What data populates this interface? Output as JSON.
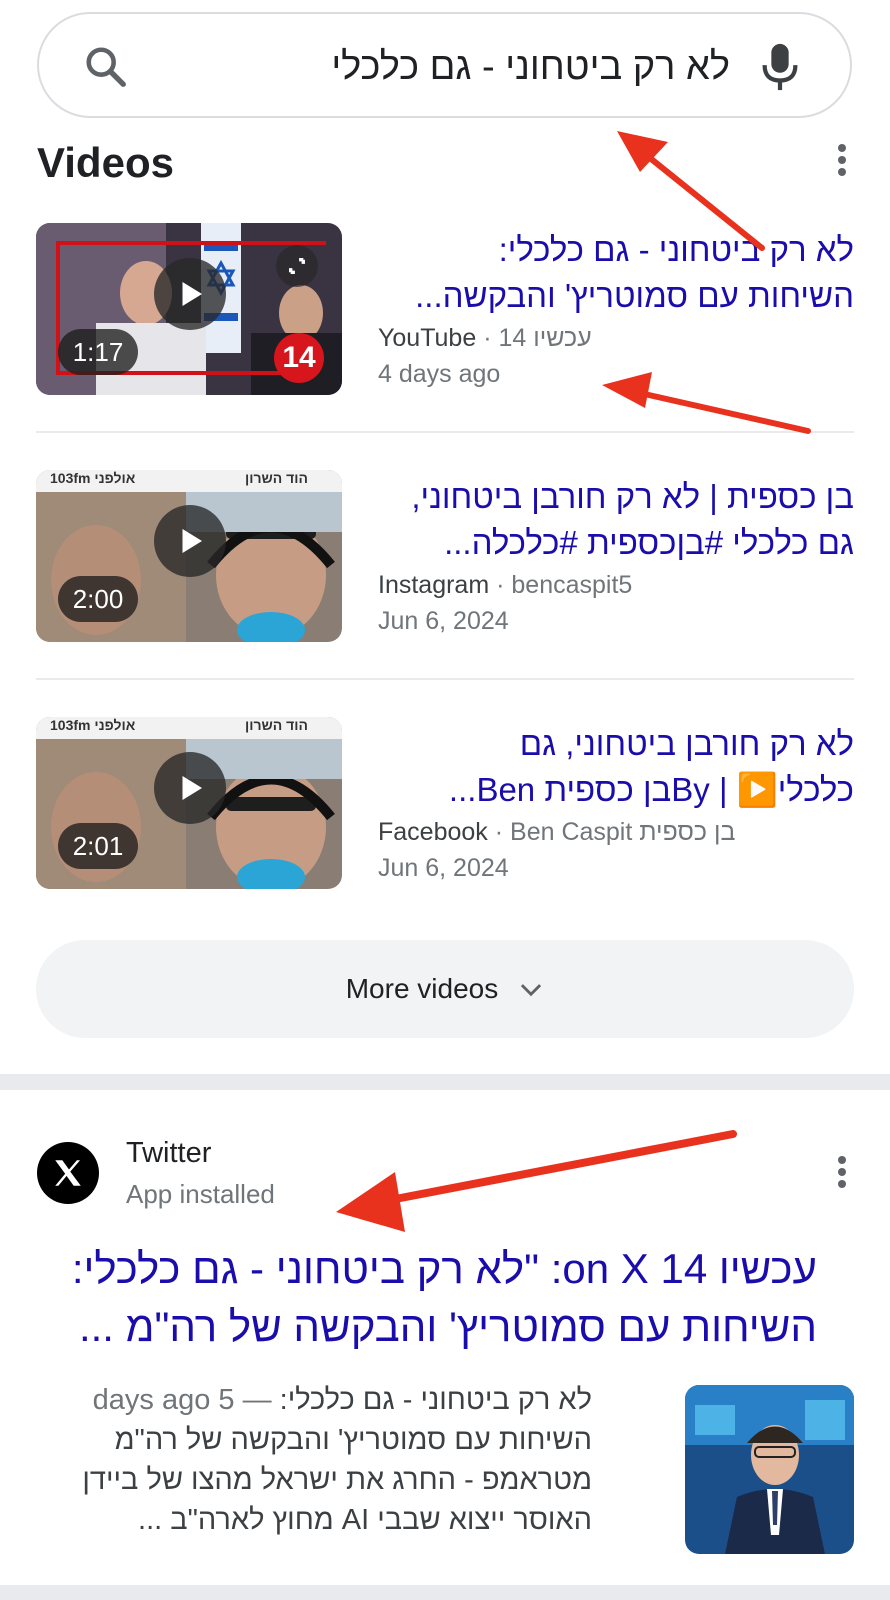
{
  "search": {
    "query": "לא רק ביטחוני - גם כלכלי",
    "icon": "search-icon",
    "mic_icon": "mic-icon"
  },
  "videos": {
    "heading": "Videos",
    "items": [
      {
        "duration": "1:17",
        "title_line1": "לא רק ביטחוני - גם כלכלי:",
        "title_line2": "השיחות עם סמוטריץ' והבקשה...",
        "source": "YouTube",
        "channel": "עכשיו 14",
        "date": "4 days ago",
        "thumb_badge": "14"
      },
      {
        "duration": "2:00",
        "title_line1": "בן כספית | לא רק חורבן ביטחוני,",
        "title_line2": "גם כלכלי #בןכספית #כלכלה...",
        "source": "Instagram",
        "channel": "bencaspit5",
        "date": "Jun 6, 2024",
        "thumb_text_left": "103fm אולפני",
        "thumb_text_right": "הוד השרון"
      },
      {
        "duration": "2:01",
        "title_line1": "לא רק חורבן ביטחוני, גם",
        "title_line2": "כלכלי▶️ | Byבן כספית Ben...",
        "source": "Facebook",
        "channel": "Ben Caspit בן כספית",
        "date": "Jun 6, 2024",
        "thumb_text_left": "103fm אולפני",
        "thumb_text_right": "הוד השרון"
      }
    ],
    "more_label": "More videos"
  },
  "twitter": {
    "name": "Twitter",
    "subtitle": "App installed",
    "title_line1": "עכשיו 14 on X: \"לא רק ביטחוני - גם כלכלי:",
    "title_line2": "השיחות עם סמוטריץ' והבקשה של רה\"מ ...",
    "snippet_date": "5 days ago",
    "snippet_line1": "לא רק ביטחוני - גם כלכלי:",
    "snippet_line2": "השיחות עם סמוטריץ' והבקשה של רה\"מ",
    "snippet_line3": "מטראמפ - החרג את ישראל מהצו של ביידן",
    "snippet_line4": "האוסר ייצוא שבבי AI מחוץ לארה\"ב ..."
  },
  "colors": {
    "link": "#1a0dab",
    "annotation_arrow": "#e8321e",
    "channel_red": "#d6151c"
  }
}
